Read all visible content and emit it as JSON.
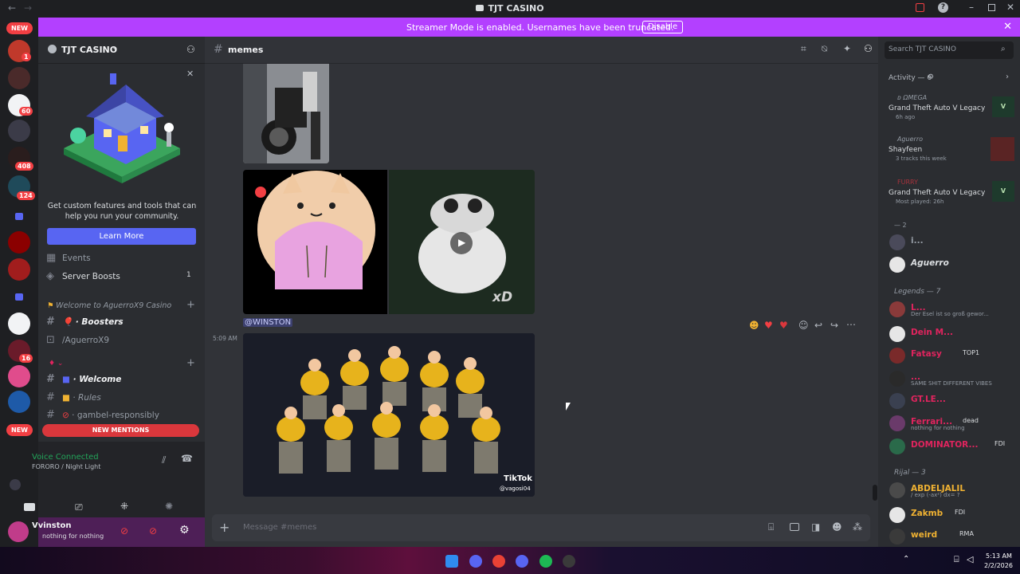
{
  "window": {
    "title": "TJT CASINO"
  },
  "banner": {
    "text": "Streamer Mode is enabled. Usernames have been truncated.",
    "button": "Disable"
  },
  "rail": {
    "badges": [
      "NEW",
      "1",
      "60",
      "408",
      "124",
      "16",
      "NEW"
    ]
  },
  "server": {
    "name": "TJT CASINO"
  },
  "promo": {
    "text": "Get custom features and tools that can help you run your community.",
    "button": "Learn More"
  },
  "channels": {
    "events": "Events",
    "boosts": "Server Boosts",
    "boosts_count": "1",
    "category1": "Welcome to AguerroX9 Casino",
    "boosters": "Boosters",
    "aguerro": "/AguerroX9",
    "welcome": "Welcome",
    "rules": "Rules",
    "gambel": "gambel-responsibly",
    "new_mentions": "NEW MENTIONS"
  },
  "voice": {
    "status": "Voice Connected",
    "channel": "FORORO / Night Light"
  },
  "user": {
    "name": "Vvinston",
    "status": "nothing for nothing"
  },
  "chat": {
    "channel": "memes",
    "mention": "@WINSTON",
    "time": "5:09 AM",
    "tiktok": "TikTok",
    "tiktok_user": "@vagosi04",
    "xd": "xD",
    "placeholder": "Message #memes"
  },
  "members": {
    "search": "Search TJT CASINO",
    "activity_header": "Activity — 6",
    "activity": [
      {
        "user": "ᴅ ΩMEGA",
        "title": "Grand Theft Auto V Legacy",
        "sub": "6h ago"
      },
      {
        "user": "Aguerro",
        "title": "Shayfeen",
        "sub": "3 tracks this week"
      },
      {
        "user": "FURRY",
        "title": "Grand Theft Auto V Legacy",
        "sub": "Most played: 26h"
      }
    ],
    "group2": "— 2",
    "group2_members": [
      "i...",
      "Aguerro"
    ],
    "legends_header": "Legends — 7",
    "legends": [
      {
        "name": "L...",
        "status": "Der Esel ist so groß gewor...",
        "color": "#e0245e"
      },
      {
        "name": "Dein M...",
        "status": "",
        "color": "#e0245e"
      },
      {
        "name": "Fatasy",
        "status": "",
        "badge": "TOP1",
        "color": "#e0245e"
      },
      {
        "name": "...",
        "status": "SAME SHIT DIFFERENT VIBES",
        "color": "#e0245e"
      },
      {
        "name": "GT.LE...",
        "status": "",
        "color": "#e0245e"
      },
      {
        "name": "Ferrari...",
        "status": "nothing for nothing",
        "badge": "dead",
        "color": "#e0245e"
      },
      {
        "name": "DOMINATOR...",
        "status": "",
        "badge": "FDI",
        "color": "#e0245e"
      }
    ],
    "rijal_header": "Rijal — 3",
    "rijal": [
      {
        "name": "ABDELJALIL",
        "status": "/ exp (-ax²) dx= ?",
        "color": "#f0b232"
      },
      {
        "name": "Zakmb",
        "status": "",
        "badge": "FDI",
        "color": "#f0b232"
      },
      {
        "name": "weird",
        "status": "",
        "badge": "RMA",
        "color": "#f0b232"
      }
    ]
  },
  "taskbar": {
    "time": "5:13 AM",
    "date": "2/2/2026"
  }
}
